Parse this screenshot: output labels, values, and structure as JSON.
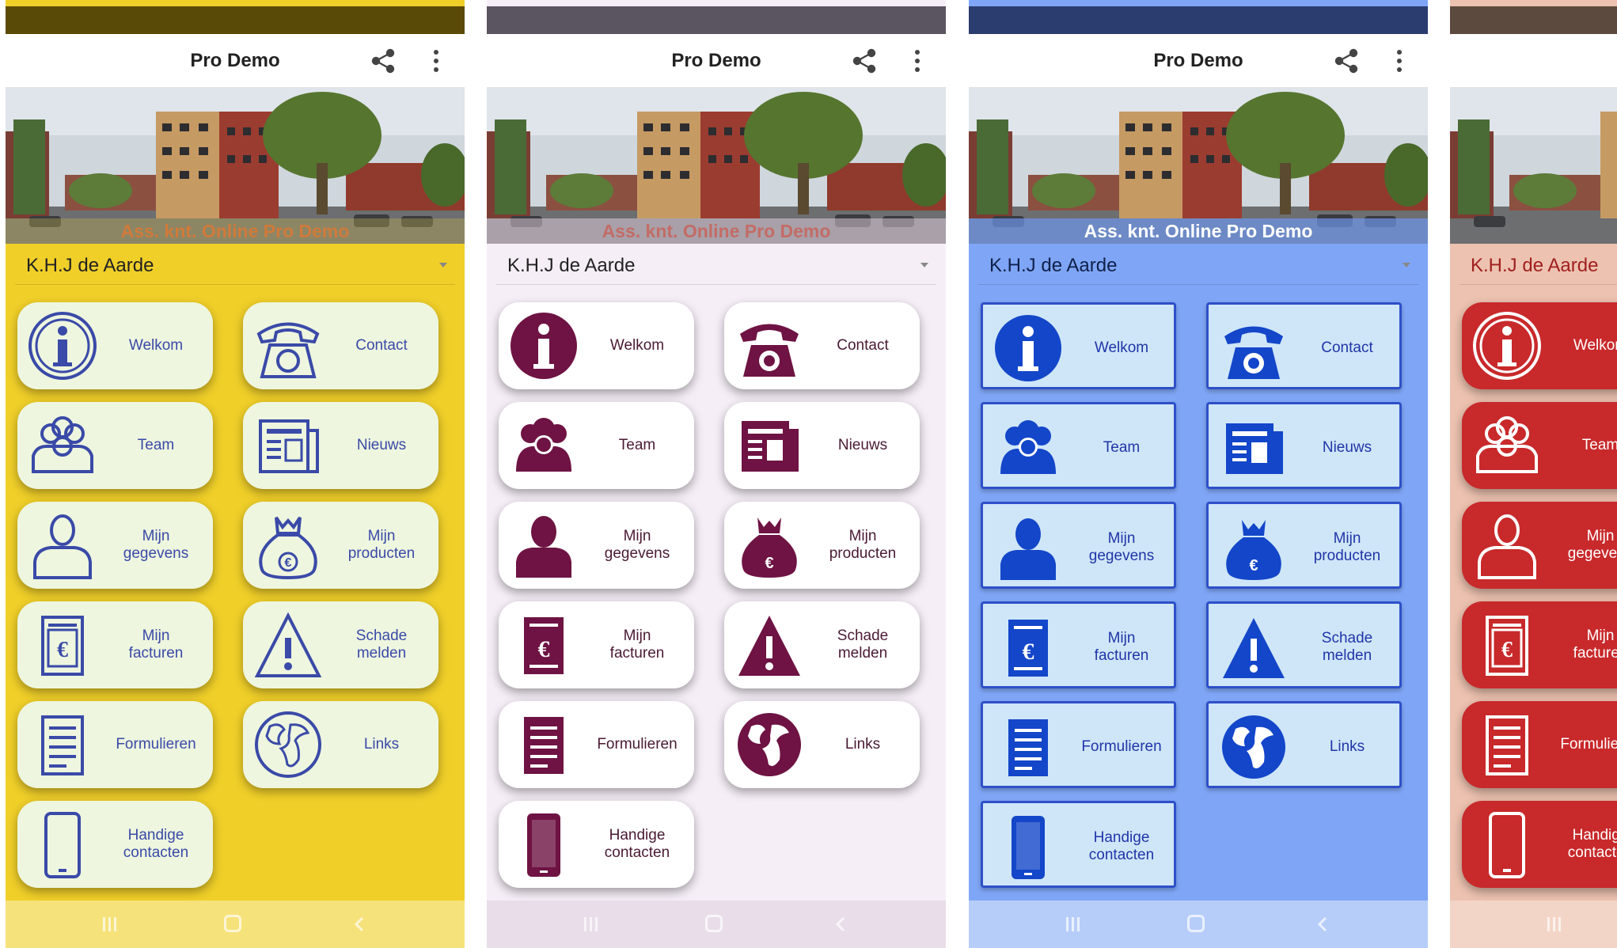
{
  "app_title": "Pro Demo",
  "banner_caption": "Ass. knt. Online Pro Demo",
  "user_name": "K.H.J de Aarde",
  "tiles": [
    {
      "label": "Welkom",
      "icon": "info-icon"
    },
    {
      "label": "Contact",
      "icon": "telephone-icon"
    },
    {
      "label": "Team",
      "icon": "team-icon"
    },
    {
      "label": "Nieuws",
      "icon": "newspaper-icon"
    },
    {
      "label": "Mijn\ngegevens",
      "icon": "user-icon"
    },
    {
      "label": "Mijn\nproducten",
      "icon": "money-bag-icon"
    },
    {
      "label": "Mijn\nfacturen",
      "icon": "invoice-icon"
    },
    {
      "label": "Schade\nmelden",
      "icon": "warning-icon"
    },
    {
      "label": "Formulieren",
      "icon": "form-icon"
    },
    {
      "label": "Links",
      "icon": "globe-icon"
    },
    {
      "label": "Handige\ncontacten",
      "icon": "phone-icon"
    }
  ],
  "themes": [
    {
      "name": "yellow",
      "icon_color": "#3a4aa8",
      "icon_style": "outline",
      "nav_color": "#f6e27a"
    },
    {
      "name": "purple",
      "icon_color": "#6e1343",
      "icon_style": "filled",
      "nav_color": "#e8dde9"
    },
    {
      "name": "blue",
      "icon_color": "#1346c9",
      "icon_style": "filled",
      "nav_color": "#b7cdf9"
    },
    {
      "name": "red",
      "icon_color": "#ffffff",
      "icon_style": "outline",
      "nav_color": "#f3d5c7"
    }
  ]
}
